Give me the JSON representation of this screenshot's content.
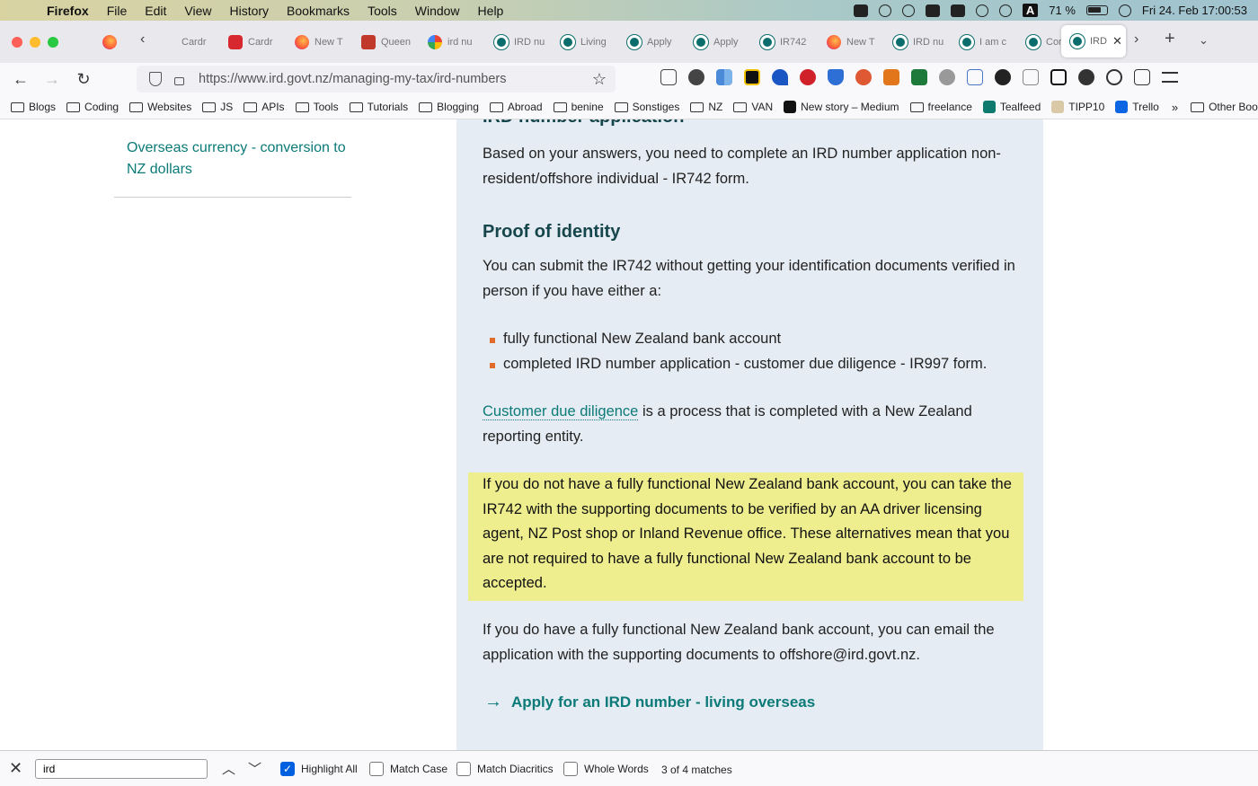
{
  "menubar": {
    "app": "Firefox",
    "items": [
      "File",
      "Edit",
      "View",
      "History",
      "Bookmarks",
      "Tools",
      "Window",
      "Help"
    ],
    "battery": "71 %",
    "datetime": "Fri 24. Feb  17:00:53",
    "input_source": "A"
  },
  "tabs": [
    {
      "label": "Cardr",
      "icon": "firefox-icon"
    },
    {
      "label": "Cardr",
      "icon": "red-logo-icon"
    },
    {
      "label": "New T",
      "icon": "firefox-icon"
    },
    {
      "label": "Queen",
      "icon": "queen-icon"
    },
    {
      "label": "ird nu",
      "icon": "google-icon"
    },
    {
      "label": "IRD nu",
      "icon": "ird-icon"
    },
    {
      "label": "Living",
      "icon": "ird-icon"
    },
    {
      "label": "Apply",
      "icon": "ird-icon"
    },
    {
      "label": "Apply",
      "icon": "ird-icon"
    },
    {
      "label": "IR742",
      "icon": "ird-icon"
    },
    {
      "label": "New T",
      "icon": "firefox-icon"
    },
    {
      "label": "IRD nu",
      "icon": "ird-icon"
    },
    {
      "label": "I am c",
      "icon": "ird-icon"
    },
    {
      "label": "Conta",
      "icon": "ird-icon"
    }
  ],
  "active_tab": {
    "label": "IRD",
    "icon": "ird-icon"
  },
  "url": "https://www.ird.govt.nz/managing-my-tax/ird-numbers",
  "bookmarks": [
    {
      "label": "Blogs",
      "icon": "folder-icon"
    },
    {
      "label": "Coding",
      "icon": "folder-icon"
    },
    {
      "label": "Websites",
      "icon": "folder-icon"
    },
    {
      "label": "JS",
      "icon": "folder-icon"
    },
    {
      "label": "APIs",
      "icon": "folder-icon"
    },
    {
      "label": "Tools",
      "icon": "folder-icon"
    },
    {
      "label": "Tutorials",
      "icon": "folder-icon"
    },
    {
      "label": "Blogging",
      "icon": "folder-icon"
    },
    {
      "label": "Abroad",
      "icon": "folder-icon"
    },
    {
      "label": "benine",
      "icon": "folder-icon"
    },
    {
      "label": "Sonstiges",
      "icon": "folder-icon"
    },
    {
      "label": "NZ",
      "icon": "folder-icon"
    },
    {
      "label": "VAN",
      "icon": "folder-icon"
    },
    {
      "label": "New story – Medium",
      "icon": "medium-icon"
    },
    {
      "label": "freelance",
      "icon": "folder-icon"
    },
    {
      "label": "Tealfeed",
      "icon": "tealfeed-icon"
    },
    {
      "label": "TIPP10",
      "icon": "tipp10-icon"
    },
    {
      "label": "Trello",
      "icon": "trello-icon"
    }
  ],
  "other_bookmarks": "Other Bookmarks",
  "sidenav": {
    "link": "Overseas currency - conversion to NZ dollars"
  },
  "content": {
    "cut_heading": "IRD number application",
    "intro": "Based on your answers, you need to complete an IRD number application non-resident/offshore individual - IR742 form.",
    "proof_heading": "Proof of identity",
    "proof_text": "You can submit the IR742 without getting your identification documents verified in person if you have either a:",
    "bullets": [
      "fully functional New Zealand bank account",
      "completed IRD number application - customer due diligence - IR997 form."
    ],
    "cdd_link": "Customer due diligence",
    "cdd_text": " is a process that is completed with a New Zealand reporting entity.",
    "highlight": "If you do not have a fully functional New Zealand bank account, you can take the IR742 with the supporting documents to be verified by an AA driver licensing agent, NZ Post shop or Inland Revenue office. These alternatives mean that you are not required to have a fully functional New Zealand bank account to be accepted.",
    "email_text": "If you do have a fully functional New Zealand bank account, you can email the application with the supporting documents to offshore@ird.govt.nz.",
    "apply_link": "Apply for an IRD number - living overseas"
  },
  "findbar": {
    "query": "ird",
    "highlight_all": "Highlight All",
    "match_case": "Match Case",
    "match_diacritics": "Match Diacritics",
    "whole_words": "Whole Words",
    "matches": "3 of 4 matches"
  },
  "colors": {
    "link": "#0b7a78",
    "heading": "#15464b",
    "content_bg": "#e6ecf3",
    "highlight_bg": "#eeee8f",
    "bullet": "#e06b2b"
  }
}
